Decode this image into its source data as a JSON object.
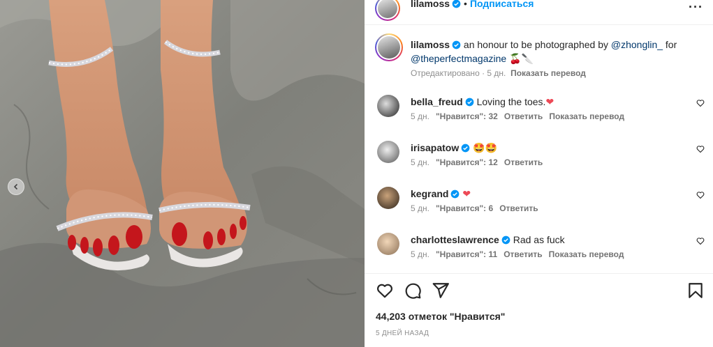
{
  "post": {
    "username": "lilamoss",
    "follow_label": "Подписаться",
    "more_label": "···",
    "caption": {
      "text_before": "an honour to be photographed by ",
      "mention1": "@zhonglin_",
      "text_middle": " for",
      "mention2": "@theperfectmagazine",
      "emojis": "🍒🔪"
    },
    "edited_label": "Отредактировано",
    "edited_time": "5 дн.",
    "translate_label": "Показать перевод"
  },
  "comments": [
    {
      "username": "bella_freud",
      "text": "Loving the toes.",
      "emoji": "❤",
      "time": "5 дн.",
      "likes": "\"Нравится\": 32",
      "reply": "Ответить",
      "translate": "Показать перевод"
    },
    {
      "username": "irisapatow",
      "text": "",
      "emoji": "🤩🤩",
      "time": "5 дн.",
      "likes": "\"Нравится\": 12",
      "reply": "Ответить",
      "translate": ""
    },
    {
      "username": "kegrand",
      "text": "",
      "emoji": "❤",
      "time": "5 дн.",
      "likes": "\"Нравится\": 6",
      "reply": "Ответить",
      "translate": ""
    },
    {
      "username": "charlotteslawrence",
      "text": "Rad as fuck",
      "emoji": "",
      "time": "5 дн.",
      "likes": "\"Нравится\": 11",
      "reply": "Ответить",
      "translate": "Показать перевод"
    }
  ],
  "footer": {
    "likes_count": "44,203",
    "likes_suffix": "отметок \"Нравится\"",
    "posted_time": "5 дней назад"
  },
  "icons": {
    "heart": "heart-icon",
    "comment": "comment-icon",
    "share": "share-icon",
    "save": "bookmark-icon",
    "verified": "verified-badge-icon",
    "prev": "chevron-left-icon"
  },
  "colors": {
    "link": "#0095f6",
    "mention": "#00376b",
    "verified": "#0095f6",
    "heart_red": "#ed4956",
    "muted": "#8e8e8e"
  }
}
